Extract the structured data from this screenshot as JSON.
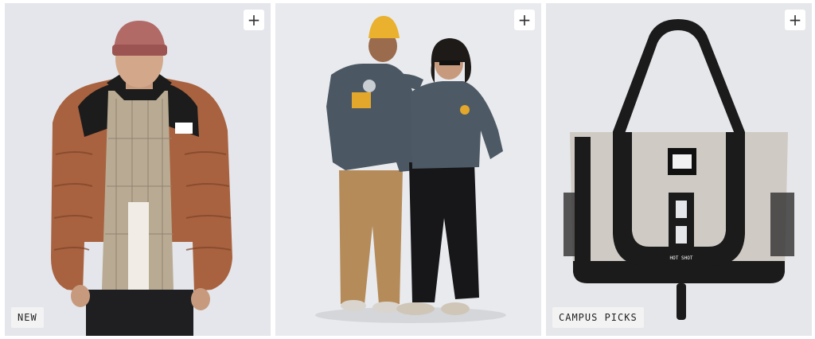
{
  "tiles": [
    {
      "add_label": "+",
      "badge": "NEW",
      "image": "man-in-brown-puffer-jacket"
    },
    {
      "add_label": "+",
      "badge": "",
      "image": "two-people-in-graphic-sweatshirts"
    },
    {
      "add_label": "+",
      "badge": "CAMPUS PICKS",
      "image": "grey-and-black-tote-bag"
    }
  ],
  "product_text": {
    "tote_patch": "HOT SHOT"
  },
  "colors": {
    "tile_bg": "#e6e7ea",
    "badge_bg": "#f3f3f3",
    "jacket": "#a8623f",
    "beanie_pink": "#b26a67",
    "beanie_yellow": "#e9b12e",
    "sweatshirt": "#4b5863",
    "tote_body": "#cfcbc4",
    "tote_strap": "#1b1b1b"
  }
}
